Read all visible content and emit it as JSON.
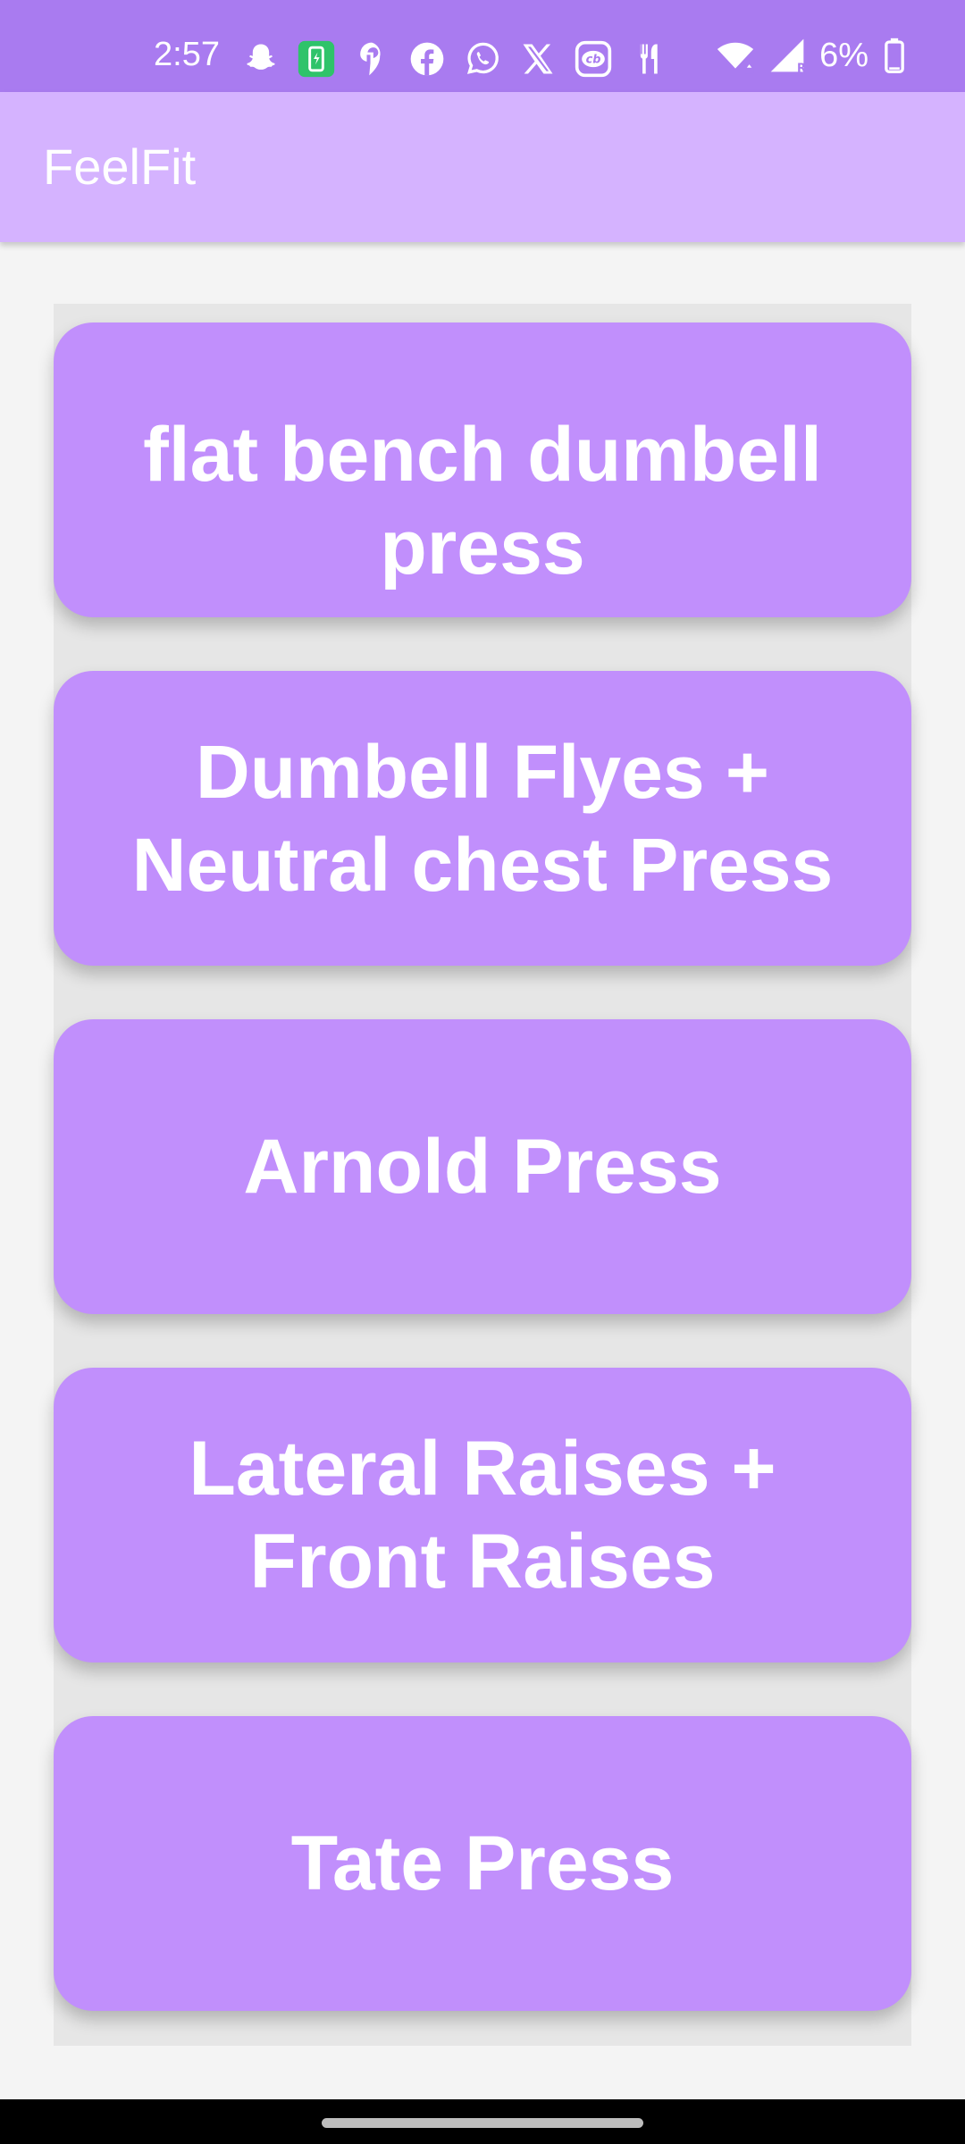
{
  "status_bar": {
    "time": "2:57",
    "battery_percent": "6%",
    "icons": [
      "snapchat-icon",
      "battery-saver-icon",
      "swiggy-icon",
      "facebook-icon",
      "whatsapp-icon",
      "x-icon",
      "cricbuzz-icon",
      "zomato-icon",
      "wifi-icon",
      "signal-icon",
      "battery-icon"
    ]
  },
  "app_bar": {
    "title": "FeelFit"
  },
  "exercises": [
    {
      "label": "flat bench dumbell press"
    },
    {
      "label": "Dumbell Flyes + Neutral chest Press"
    },
    {
      "label": "Arnold Press"
    },
    {
      "label": "Lateral Raises + Front Raises"
    },
    {
      "label": "Tate Press"
    }
  ],
  "colors": {
    "status_bar": "#a97bf0",
    "app_bar": "#d5b3ff",
    "card": "#c18ffc",
    "background": "#f4f4f4"
  }
}
